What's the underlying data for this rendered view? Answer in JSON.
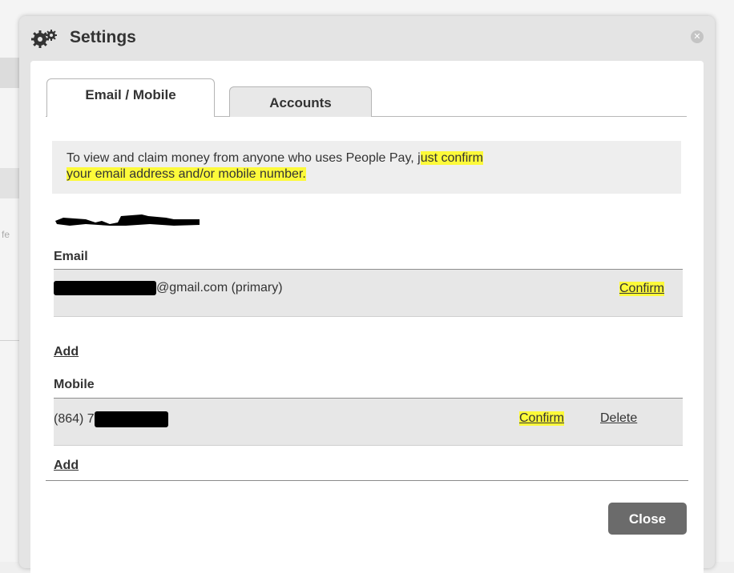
{
  "dialog": {
    "title": "Settings",
    "title_icon": "gears-icon",
    "close_icon": "close-icon"
  },
  "tabs": [
    {
      "label": "Email / Mobile",
      "active": true
    },
    {
      "label": "Accounts",
      "active": false
    }
  ],
  "notice": {
    "text_plain": "To view and claim money from anyone who uses People Pay, j",
    "text_highlighted_1": "ust confirm",
    "text_highlighted_2": "your email address and/or mobile number."
  },
  "email_section": {
    "label": "Email",
    "value_suffix": "@gmail.com (primary)",
    "confirm_label": "Confirm",
    "add_label": "Add"
  },
  "mobile_section": {
    "label": "Mobile",
    "value_prefix": "(864) 7",
    "confirm_label": "Confirm",
    "delete_label": "Delete",
    "add_label": "Add"
  },
  "footer": {
    "close_label": "Close"
  },
  "colors": {
    "highlight": "#fdfa3a",
    "close_button": "#6b6b6b",
    "row_background": "#e7e7e7",
    "notice_background": "#eeeeee"
  }
}
